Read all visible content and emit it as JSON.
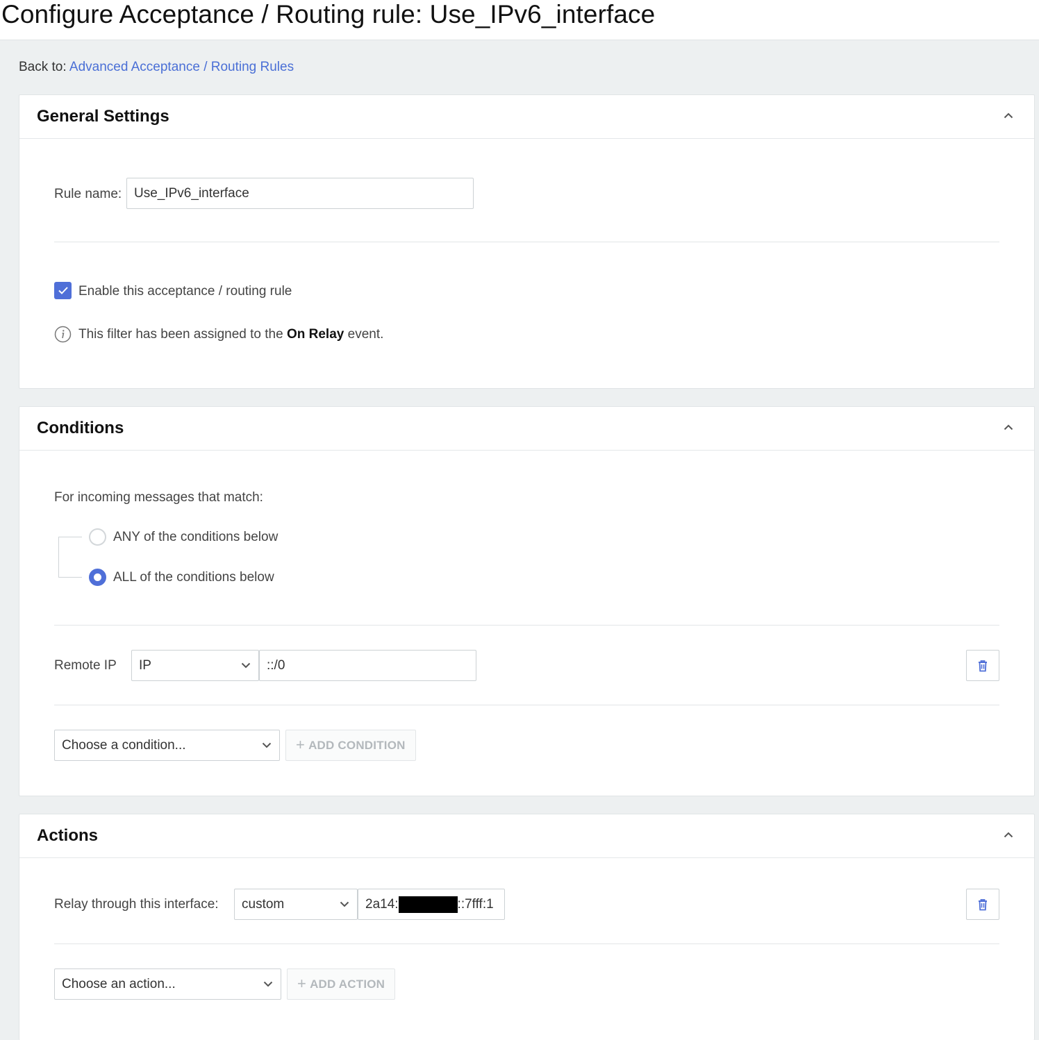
{
  "page": {
    "title": "Configure Acceptance / Routing rule: Use_IPv6_interface",
    "back_prefix": "Back to:",
    "back_link": "Advanced Acceptance / Routing Rules"
  },
  "general": {
    "title": "General Settings",
    "rule_name_label": "Rule name:",
    "rule_name_value": "Use_IPv6_interface",
    "enable_label": "Enable this acceptance / routing rule",
    "enabled": true,
    "info_prefix": "This filter has been assigned to the",
    "info_event": "On Relay",
    "info_suffix": "event."
  },
  "conditions": {
    "title": "Conditions",
    "match_label": "For incoming messages that match:",
    "any_label": "ANY of the conditions below",
    "all_label": "ALL of the conditions below",
    "selected": "all",
    "row": {
      "label": "Remote IP",
      "type_value": "IP",
      "ip_value": "::/0"
    },
    "choose_placeholder": "Choose a condition...",
    "add_label": "ADD CONDITION"
  },
  "actions": {
    "title": "Actions",
    "row": {
      "label": "Relay through this interface:",
      "type_value": "custom",
      "addr_prefix": "2a14:",
      "addr_suffix": "::7fff:1"
    },
    "choose_placeholder": "Choose an action...",
    "add_label": "ADD ACTION"
  },
  "colors": {
    "accent": "#4f6fd8",
    "link": "#4a6fd6",
    "background": "#edf0f1"
  }
}
